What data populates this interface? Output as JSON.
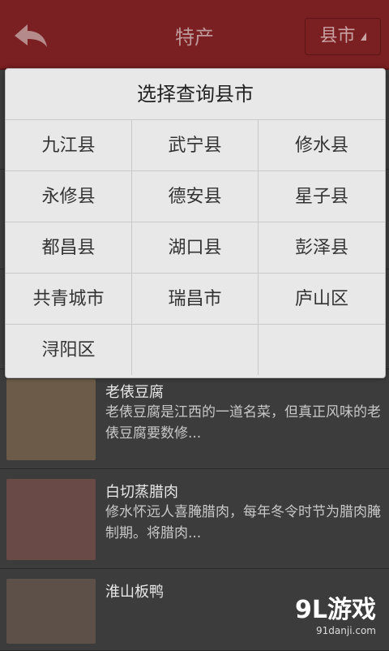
{
  "header": {
    "title": "特产",
    "region_label": "县市"
  },
  "dialog": {
    "title": "选择查询县市",
    "options": [
      "九江县",
      "武宁县",
      "修水县",
      "永修县",
      "德安县",
      "星子县",
      "都昌县",
      "湖口县",
      "彭泽县",
      "共青城市",
      "瑞昌市",
      "庐山区",
      "浔阳区"
    ]
  },
  "list": [
    {
      "title": "老俵豆腐",
      "desc": "老俵豆腐是江西的一道名菜，但真正风味的老俵豆腐要数修..."
    },
    {
      "title": "白切蒸腊肉",
      "desc": "修水怀远人喜腌腊肉，每年冬令时节为腊肉腌制期。将腊肉..."
    },
    {
      "title": "淮山板鸭",
      "desc": ""
    }
  ],
  "watermark": {
    "main": "9L游戏",
    "sub": "91danji.com"
  }
}
